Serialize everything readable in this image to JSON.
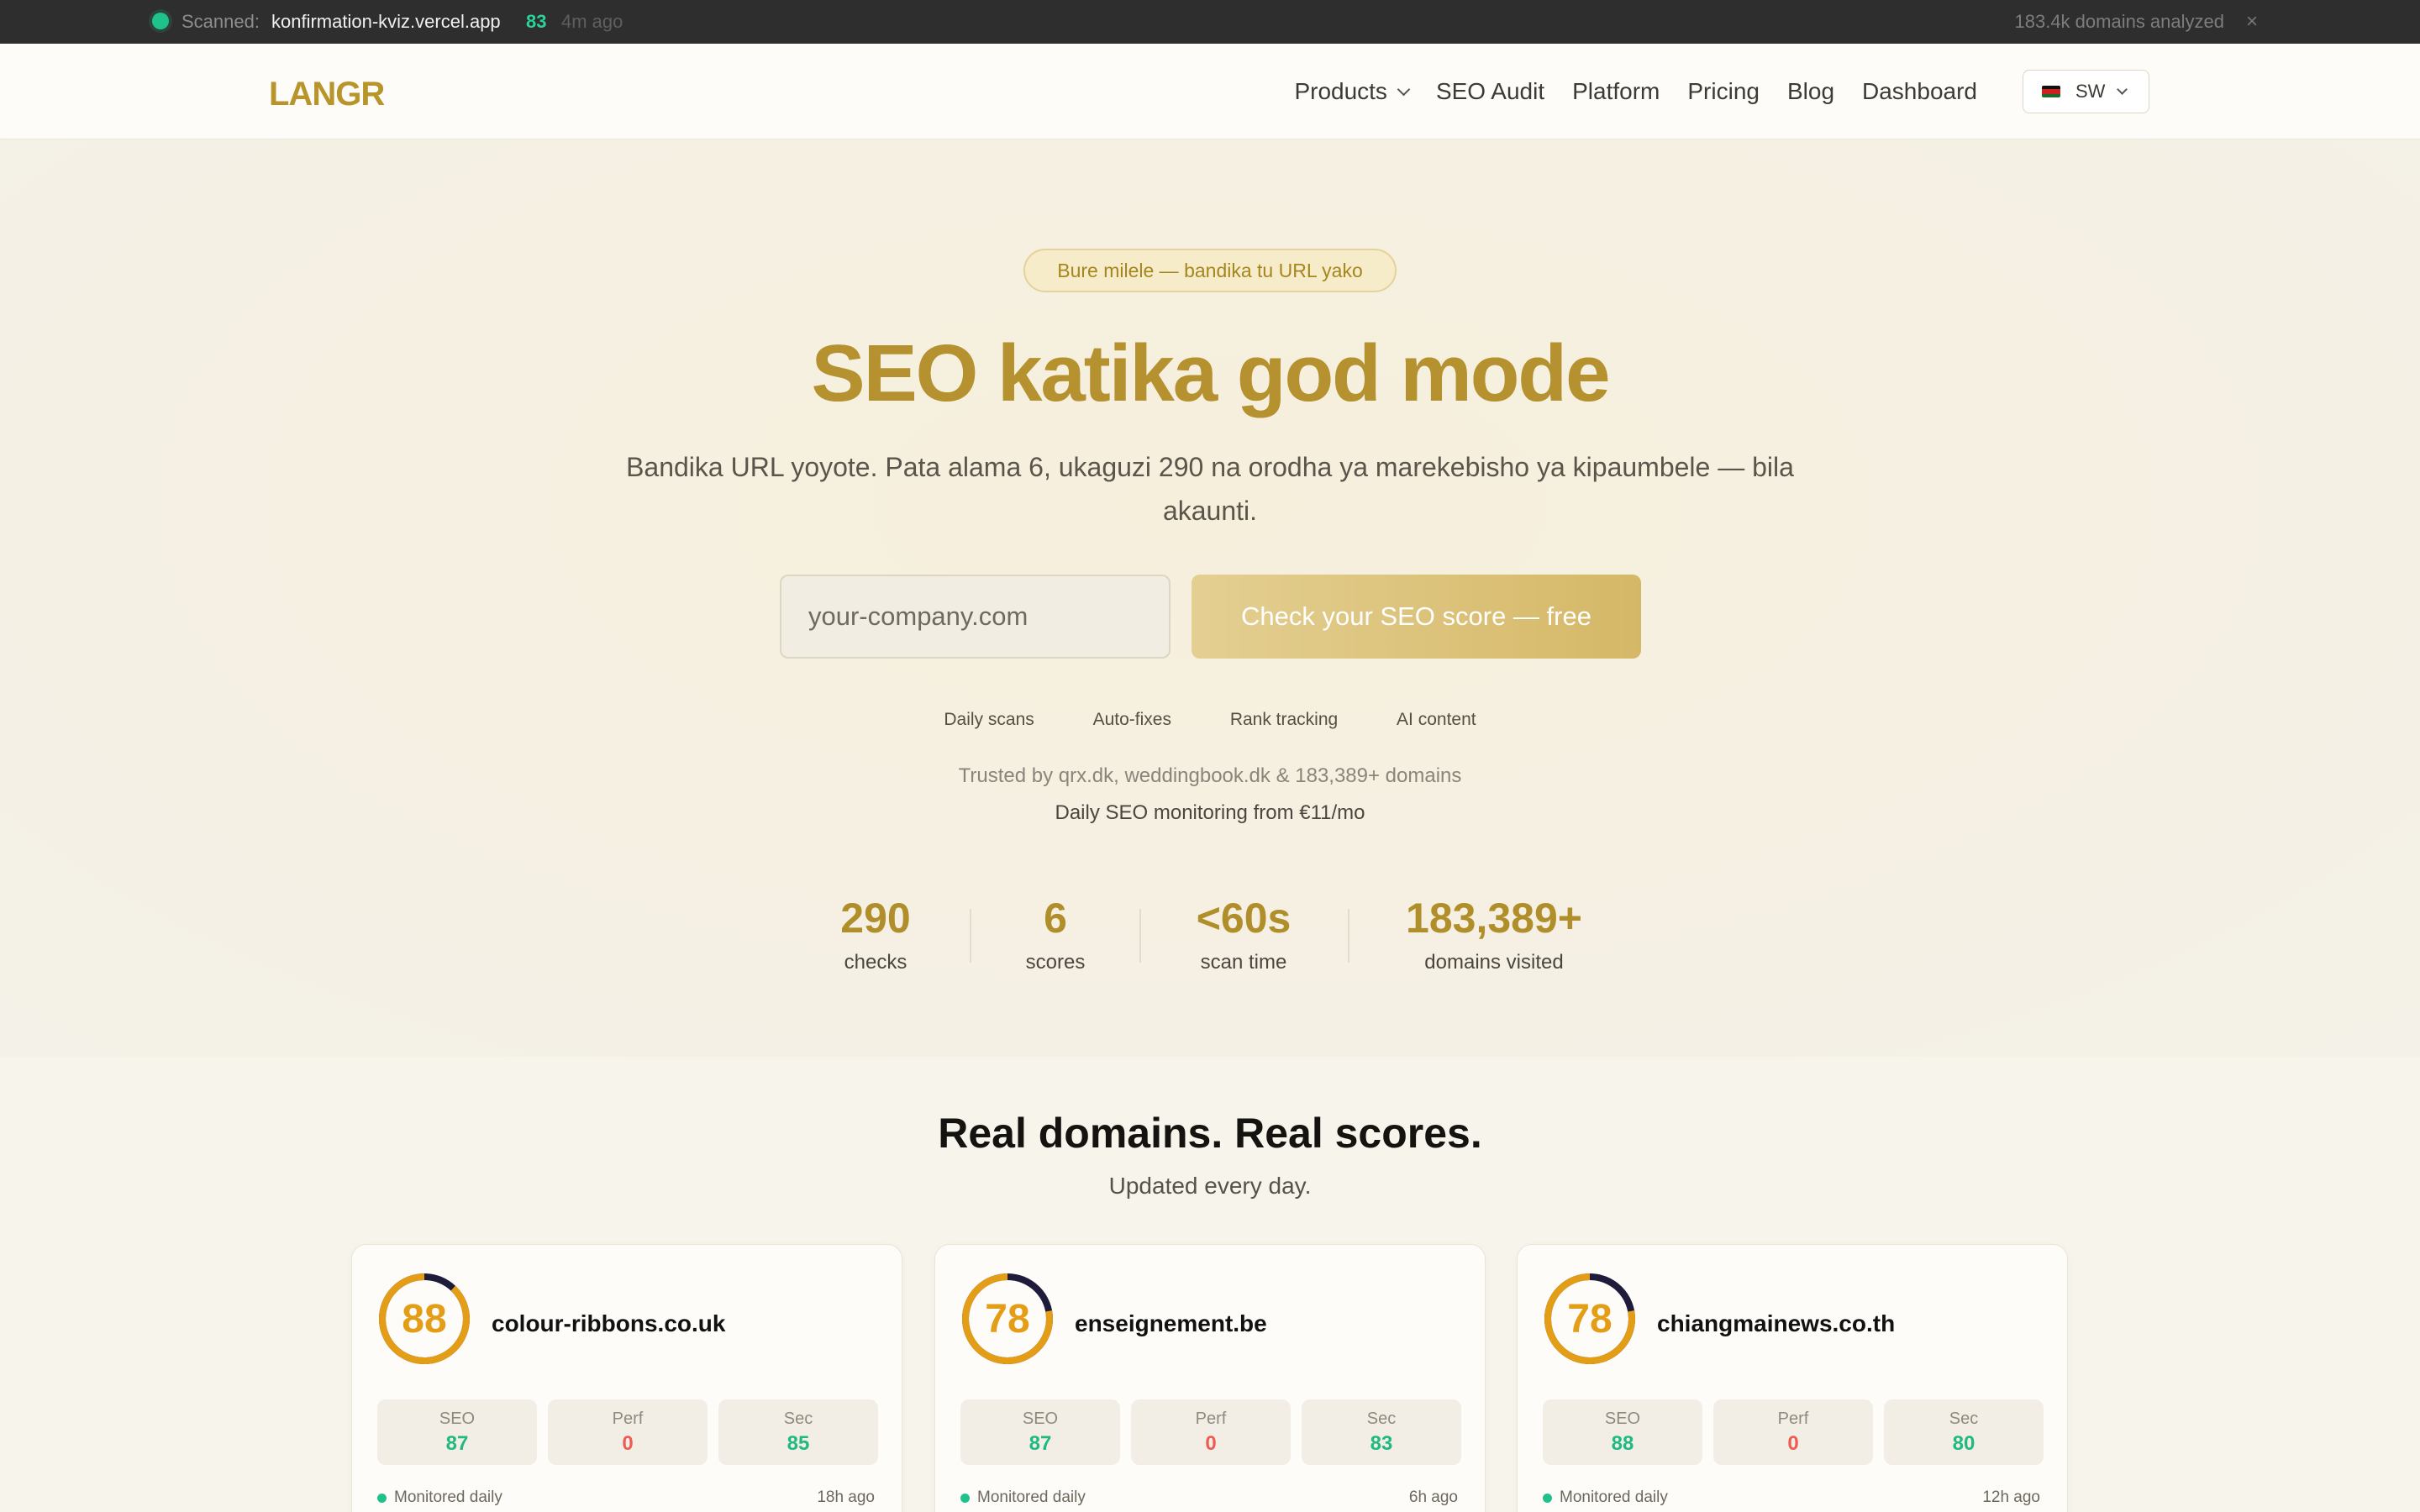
{
  "ticker": {
    "label": "Scanned:",
    "domain": "konfirmation-kviz.vercel.app",
    "score": "83",
    "time": "4m ago",
    "count": "183.4k domains analyzed",
    "close": "×"
  },
  "nav": {
    "logo": "LANGR",
    "links": [
      "Products",
      "SEO Audit",
      "Platform",
      "Pricing",
      "Blog",
      "Dashboard"
    ],
    "language": "SW"
  },
  "hero": {
    "badge": "Bure milele — bandika tu URL yako",
    "headline": "SEO katika god mode",
    "subtitle": "Bandika URL yoyote. Pata alama 6, ukaguzi 290 na orodha ya marekebisho ya kipaumbele — bila akaunti.",
    "input_placeholder": "your-company.com",
    "cta": "Check your SEO score — free",
    "features": [
      "Daily scans",
      "Auto-fixes",
      "Rank tracking",
      "AI content"
    ],
    "trusted": "Trusted by qrx.dk, weddingbook.dk & 183,389+ domains",
    "pricing_line": "Daily SEO monitoring from €11/mo"
  },
  "stats": [
    {
      "value": "290",
      "label": "checks"
    },
    {
      "value": "6",
      "label": "scores"
    },
    {
      "value": "<60s",
      "label": "scan time"
    },
    {
      "value": "183,389+",
      "label": "domains visited"
    }
  ],
  "showcase": {
    "title": "Real domains. Real scores.",
    "subtitle": "Updated every day.",
    "monitored_label": "Monitored daily",
    "metric_labels": [
      "SEO",
      "Perf",
      "Sec"
    ],
    "cards": [
      {
        "score": 88,
        "domain": "colour-ribbons.co.uk",
        "seo": "87",
        "perf": "0",
        "sec": "85",
        "ago": "18h ago"
      },
      {
        "score": 78,
        "domain": "enseignement.be",
        "seo": "87",
        "perf": "0",
        "sec": "83",
        "ago": "6h ago"
      },
      {
        "score": 78,
        "domain": "chiangmainews.co.th",
        "seo": "88",
        "perf": "0",
        "sec": "80",
        "ago": "12h ago"
      }
    ]
  },
  "colors": {
    "brand_gold": "#b8952b",
    "gauge_orange": "#e49d16",
    "good_green": "#1fb981",
    "bad_red": "#ee5b52"
  }
}
